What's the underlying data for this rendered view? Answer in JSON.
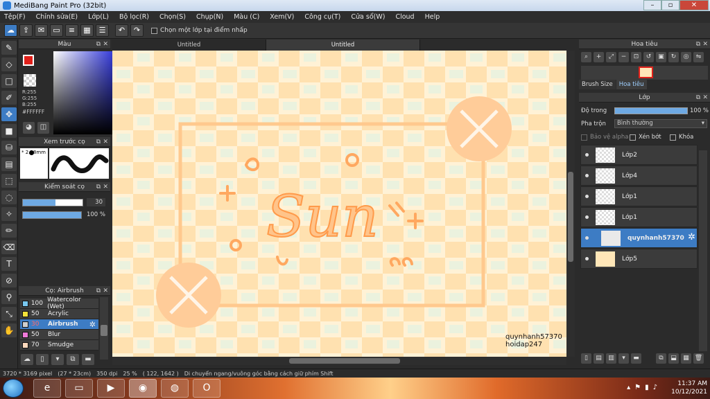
{
  "window": {
    "title": "MediBang Paint Pro (32bit)"
  },
  "menu": [
    "Tệp(F)",
    "Chỉnh sửa(E)",
    "Lớp(L)",
    "Bộ lọc(R)",
    "Chọn(S)",
    "Chụp(N)",
    "Màu (C)",
    "Xem(V)",
    "Công cụ(T)",
    "Cửa sổ(W)",
    "Cloud",
    "Help"
  ],
  "toolbar": {
    "select_layer_label": "Chọn một lớp tại điểm nhấp"
  },
  "color_panel": {
    "title": "Màu",
    "r": "R:255",
    "g": "G:255",
    "b": "B:255",
    "hex": "#FFFFFF",
    "fg_color": "#e0201a"
  },
  "brush_preview": {
    "title": "Xem trước cọ",
    "size": "2.18mm"
  },
  "brush_control": {
    "title": "Kiểm soát cọ",
    "size_value": "30",
    "size_fraction": 0.55,
    "opacity_value": "100 %",
    "opacity_fraction": 1.0
  },
  "brush_list": {
    "title": "Cọ: Airbrush",
    "items": [
      {
        "size": "100",
        "name": "Watercolor (Wet)",
        "color": "#79c8f0"
      },
      {
        "size": "50",
        "name": "Acrylic",
        "color": "#f2e23a"
      },
      {
        "size": "30",
        "name": "Airbrush",
        "color": "#cfcfcf",
        "selected": true
      },
      {
        "size": "50",
        "name": "Blur",
        "color": "#f07ad8"
      },
      {
        "size": "70",
        "name": "Smudge",
        "color": "#ffd9bd"
      }
    ]
  },
  "tabs": [
    "Untitled",
    "Untitled"
  ],
  "canvas": {
    "artwork_text": "Sun",
    "watermark_line1": "quynhanh57370",
    "watermark_line2": "hoidap247"
  },
  "navigator": {
    "title": "Hoa tiêu",
    "tab_brush_size": "Brush Size",
    "tab_navigator": "Hoa tiêu"
  },
  "layer_panel": {
    "title": "Lớp",
    "opacity_label": "Độ trong",
    "opacity_value": "100 %",
    "opacity_fraction": 1.0,
    "blend_label": "Pha trộn",
    "blend_value": "Bình thường",
    "protect_alpha": "Bảo vệ alpha",
    "clipping": "Xén bớt",
    "lock": "Khóa",
    "layers": [
      {
        "name": "Lớp2"
      },
      {
        "name": "Lớp4"
      },
      {
        "name": "Lớp1"
      },
      {
        "name": "Lớp1"
      },
      {
        "name": "quynhanh57370",
        "selected": true
      },
      {
        "name": "Lớp5"
      }
    ]
  },
  "status": {
    "pixels": "3720 * 3169 pixel",
    "size": "(27 * 23cm)",
    "dpi": "350 dpi",
    "zoom": "25 %",
    "coords": "( 122, 1642 )",
    "hint": "Di chuyển ngang/vuông góc bằng cách giữ phím Shift"
  },
  "taskbar": {
    "time": "11:37 AM",
    "date": "10/12/2021"
  }
}
